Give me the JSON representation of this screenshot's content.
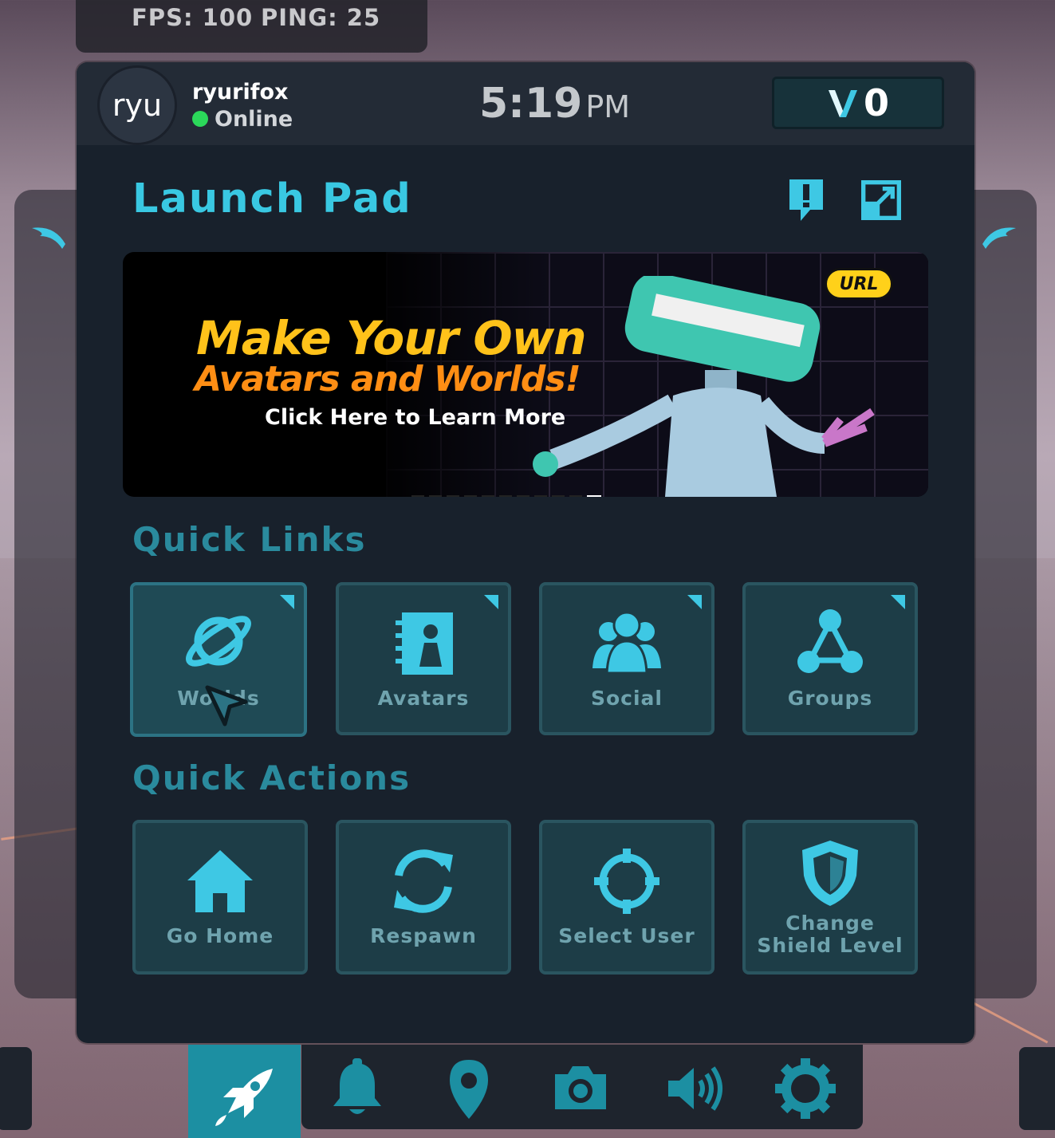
{
  "stats": {
    "fps": "FPS: 100",
    "ping": "PING: 25"
  },
  "user": {
    "avatar_text": "ryu",
    "name": "ryurifox",
    "status": "Online"
  },
  "clock": {
    "time": "5:19",
    "ampm": "PM"
  },
  "credits": {
    "value": "0"
  },
  "panel": {
    "title": "Launch Pad"
  },
  "banner": {
    "line1": "Make Your Own",
    "line2": "Avatars and Worlds!",
    "line3": "Click Here to Learn More",
    "tag": "URL",
    "slides_total": 11,
    "slide_active": 11
  },
  "quick_links": {
    "heading": "Quick Links",
    "items": [
      {
        "label": "Worlds",
        "icon": "planet-icon"
      },
      {
        "label": "Avatars",
        "icon": "avatar-book-icon"
      },
      {
        "label": "Social",
        "icon": "people-icon"
      },
      {
        "label": "Groups",
        "icon": "groups-icon"
      }
    ]
  },
  "quick_actions": {
    "heading": "Quick Actions",
    "items": [
      {
        "label": "Go Home",
        "icon": "home-icon"
      },
      {
        "label": "Respawn",
        "icon": "respawn-icon"
      },
      {
        "label": "Select User",
        "icon": "crosshair-icon"
      },
      {
        "label": "Change Shield Level",
        "icon": "shield-icon"
      }
    ]
  },
  "nav": [
    "rocket-icon",
    "bell-icon",
    "location-pin-icon",
    "camera-icon",
    "speaker-icon",
    "gear-icon"
  ],
  "colors": {
    "accent": "#39c8e2",
    "tile_bg": "#1d3d47",
    "panel_bg": "#18212c",
    "nav_active": "#1c8fa2",
    "online": "#2bd85a"
  }
}
